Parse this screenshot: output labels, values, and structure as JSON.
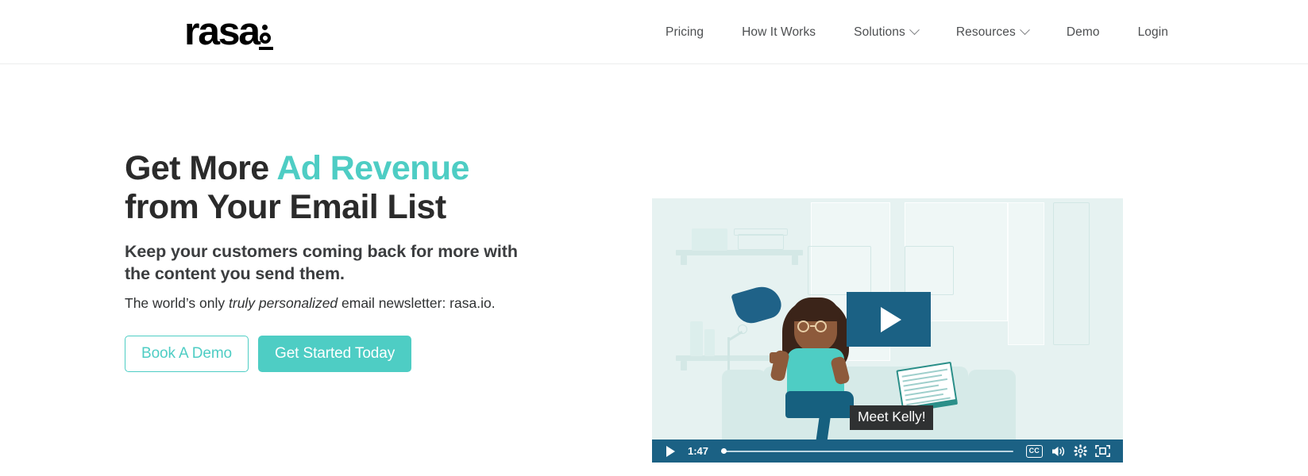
{
  "header": {
    "logo": {
      "word": "rasa",
      "mark": "io-dot-mark",
      "alt": "rasa.io"
    },
    "nav": [
      {
        "label": "Pricing",
        "has_dropdown": false
      },
      {
        "label": "How It Works",
        "has_dropdown": false
      },
      {
        "label": "Solutions",
        "has_dropdown": true
      },
      {
        "label": "Resources",
        "has_dropdown": true
      },
      {
        "label": "Demo",
        "has_dropdown": false
      },
      {
        "label": "Login",
        "has_dropdown": false
      }
    ]
  },
  "hero": {
    "headline_part1": "Get More ",
    "headline_accent": "Ad Revenue",
    "headline_part2": "from Your Email List",
    "subhead": "Keep your customers coming back for more with the content you send them.",
    "tagline_pre": "The world’s only ",
    "tagline_em": "truly personalized",
    "tagline_post": " email newsletter: rasa.io.",
    "cta_secondary": "Book A Demo",
    "cta_primary": "Get Started Today",
    "accent_color": "#4ecdc4",
    "headline_color": "#2b2b2b"
  },
  "video": {
    "caption_label": "Meet Kelly!",
    "play_overlay": "play-button",
    "current_time": "1:47",
    "progress_percent": 0,
    "controls": {
      "play": "play-icon",
      "captions": "CC",
      "volume": "volume-icon",
      "settings": "gear-icon",
      "fullscreen": "fullscreen-icon"
    },
    "bar_color": "#1b6184",
    "scene_bg": "#e6f2f1"
  }
}
